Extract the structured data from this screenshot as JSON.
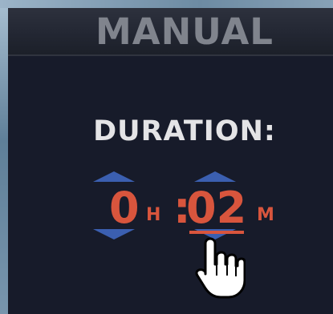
{
  "header": {
    "title": "MANUAL"
  },
  "duration": {
    "label": "DURATION:",
    "hours": "0",
    "hours_unit": "H",
    "separator": ":",
    "minutes": "02",
    "minutes_unit": "M"
  },
  "icons": {
    "increment": "chevron-up-icon",
    "decrement": "chevron-down-icon",
    "pointer": "hand-pointer-icon"
  },
  "colors": {
    "panel_background": "#171b2a",
    "header_text": "#80848d",
    "label_text": "#e4e4e6",
    "value_text": "#d8553d",
    "arrow": "#3b5fb0"
  }
}
